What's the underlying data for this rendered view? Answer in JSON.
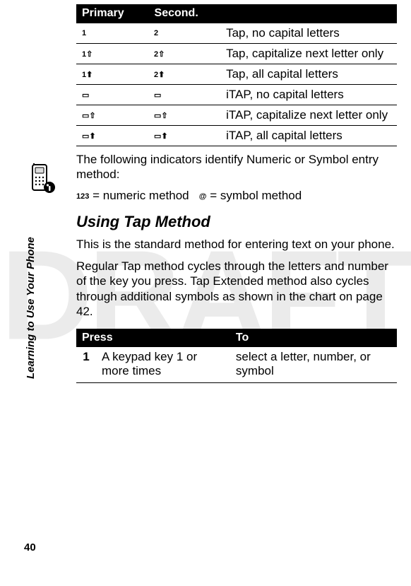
{
  "watermark": "DRAFT",
  "sidebar_label": "Learning to Use Your Phone",
  "page_number": "40",
  "modes_table": {
    "headers": {
      "primary": "Primary",
      "second": "Second."
    },
    "rows": [
      {
        "primary_icon": "1",
        "second_icon": "2",
        "desc": "Tap, no capital letters"
      },
      {
        "primary_icon": "1⇧",
        "second_icon": "2⇧",
        "desc": "Tap, capitalize next letter only"
      },
      {
        "primary_icon": "1⬆",
        "second_icon": "2⬆",
        "desc": "Tap, all capital letters"
      },
      {
        "primary_icon": "▭",
        "second_icon": "▭",
        "desc": "iTAP, no capital letters"
      },
      {
        "primary_icon": "▭⇧",
        "second_icon": "▭⇧",
        "desc": "iTAP, capitalize next letter only"
      },
      {
        "primary_icon": "▭⬆",
        "second_icon": "▭⬆",
        "desc": " iTAP, all capital letters"
      }
    ]
  },
  "para_after_table": "The following indicators identify Numeric or Symbol entry method:",
  "methods_line": {
    "numeric_sym": "123",
    "numeric_text": " = numeric method",
    "symbol_sym": "@",
    "symbol_text": " = symbol method"
  },
  "section_heading": "Using Tap Method",
  "section_p1": "This is the standard method for entering text on your phone.",
  "section_p2": "Regular Tap method cycles through the letters and number of the key you press. Tap Extended method also cycles through additional symbols as shown in the chart on page 42.",
  "press_table": {
    "headers": {
      "press": "Press",
      "to": "To"
    },
    "row": {
      "step": "1",
      "press": "A keypad key 1 or more times",
      "to": "select a letter, number, or symbol"
    }
  }
}
